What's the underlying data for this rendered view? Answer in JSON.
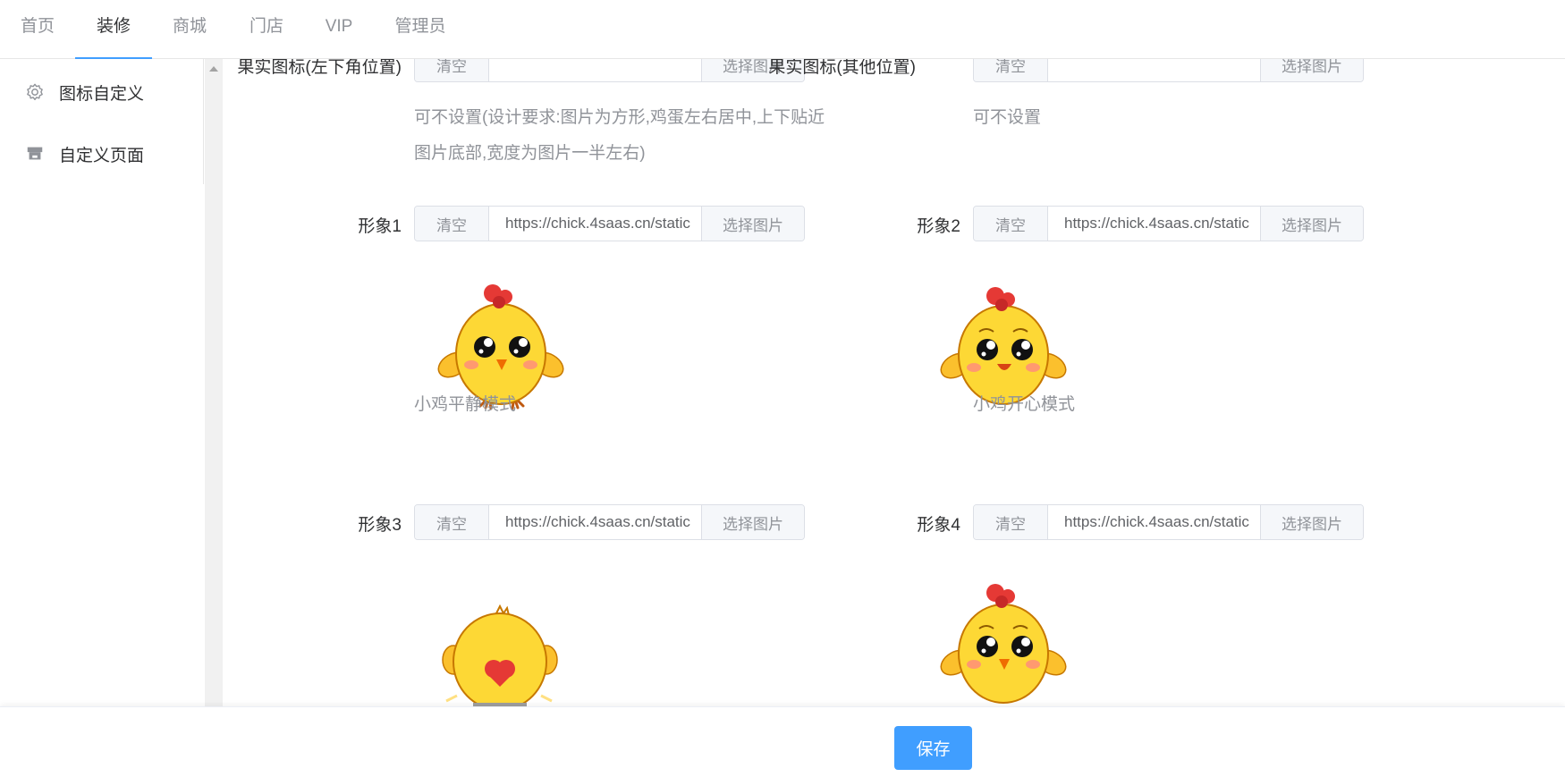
{
  "nav": {
    "tabs": [
      "首页",
      "装修",
      "商城",
      "门店",
      "VIP",
      "管理员"
    ],
    "active": "装修"
  },
  "sidebar": {
    "items": [
      {
        "label": "图标自定义",
        "icon": "gear-icon"
      },
      {
        "label": "自定义页面",
        "icon": "storefront-icon"
      }
    ]
  },
  "fields": {
    "fruit_left": {
      "label": "果实图标(左下角位置)",
      "clear": "清空",
      "value": "",
      "choose": "选择图片",
      "hint_line1": "可不设置(设计要求:图片为方形,鸡蛋左右居中,上下贴近",
      "hint_line2": "图片底部,宽度为图片一半左右)"
    },
    "fruit_other": {
      "label": "果实图标(其他位置)",
      "clear": "清空",
      "value": "",
      "choose": "选择图片",
      "hint": "可不设置"
    },
    "image1": {
      "label": "形象1",
      "clear": "清空",
      "value": "https://chick.4saas.cn/static",
      "choose": "选择图片",
      "caption": "小鸡平静模式"
    },
    "image2": {
      "label": "形象2",
      "clear": "清空",
      "value": "https://chick.4saas.cn/static",
      "choose": "选择图片",
      "caption": "小鸡开心模式"
    },
    "image3": {
      "label": "形象3",
      "clear": "清空",
      "value": "https://chick.4saas.cn/static",
      "choose": "选择图片"
    },
    "image4": {
      "label": "形象4",
      "clear": "清空",
      "value": "https://chick.4saas.cn/static",
      "choose": "选择图片"
    }
  },
  "footer": {
    "save_label": "保存"
  },
  "colors": {
    "primary": "#409eff",
    "chick_body": "#fdd835",
    "chick_comb": "#e53935"
  }
}
